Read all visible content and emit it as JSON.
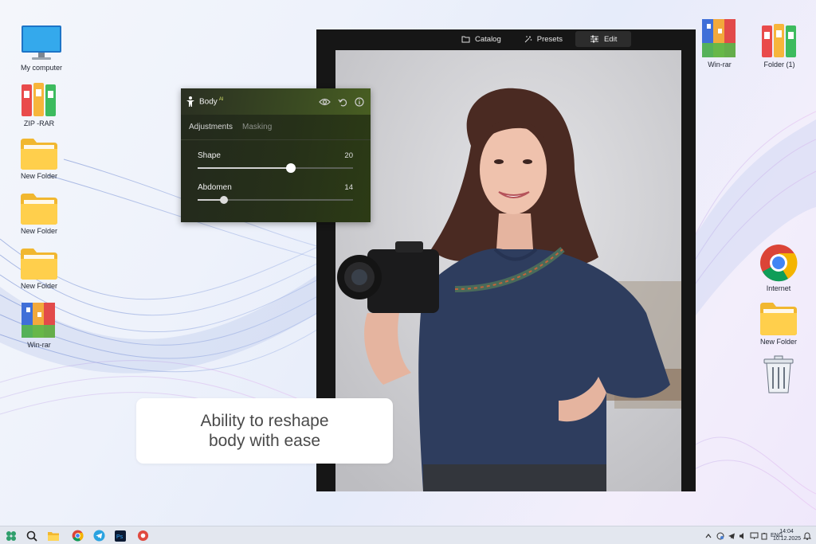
{
  "desktop_left": [
    {
      "label": "My computer",
      "icon": "monitor-icon"
    },
    {
      "label": "ZIP -RAR",
      "icon": "zip-binders-icon"
    },
    {
      "label": "New Folder",
      "icon": "folder-icon"
    },
    {
      "label": "New Folder",
      "icon": "folder-icon"
    },
    {
      "label": "New Folder",
      "icon": "folder-icon"
    },
    {
      "label": "Win-rar",
      "icon": "winrar-icon"
    }
  ],
  "desktop_right": [
    {
      "label": "Win-rar",
      "icon": "winrar-icon"
    },
    {
      "label": "Folder (1)",
      "icon": "zip-binders-icon"
    },
    {
      "label": "Internet",
      "icon": "chrome-icon"
    },
    {
      "label": "New Folder",
      "icon": "folder-icon"
    },
    {
      "label": "",
      "icon": "recycle-bin-icon"
    }
  ],
  "editor": {
    "tabs": [
      {
        "label": "Catalog",
        "icon": "folder-outline-icon"
      },
      {
        "label": "Presets",
        "icon": "magic-wand-icon"
      },
      {
        "label": "Edit",
        "icon": "sliders-icon",
        "active": true
      }
    ]
  },
  "panel": {
    "title": "Body",
    "badge": "AI",
    "tabs": [
      "Adjustments",
      "Masking"
    ],
    "active_tab": "Adjustments",
    "sliders": [
      {
        "label": "Shape",
        "value": "20",
        "level": 0.6
      },
      {
        "label": "Abdomen",
        "value": "14",
        "level": 0.17
      }
    ]
  },
  "caption": {
    "line1": "Ability to reshape",
    "line2": "body with ease"
  },
  "taskbar": {
    "lang": "ENG",
    "time": "14:04",
    "date": "10.12.2025"
  },
  "colors": {
    "panel_bg": "#263019",
    "ai_badge": "#d7e46a",
    "taskbar_bg": "#e3e7ef"
  }
}
